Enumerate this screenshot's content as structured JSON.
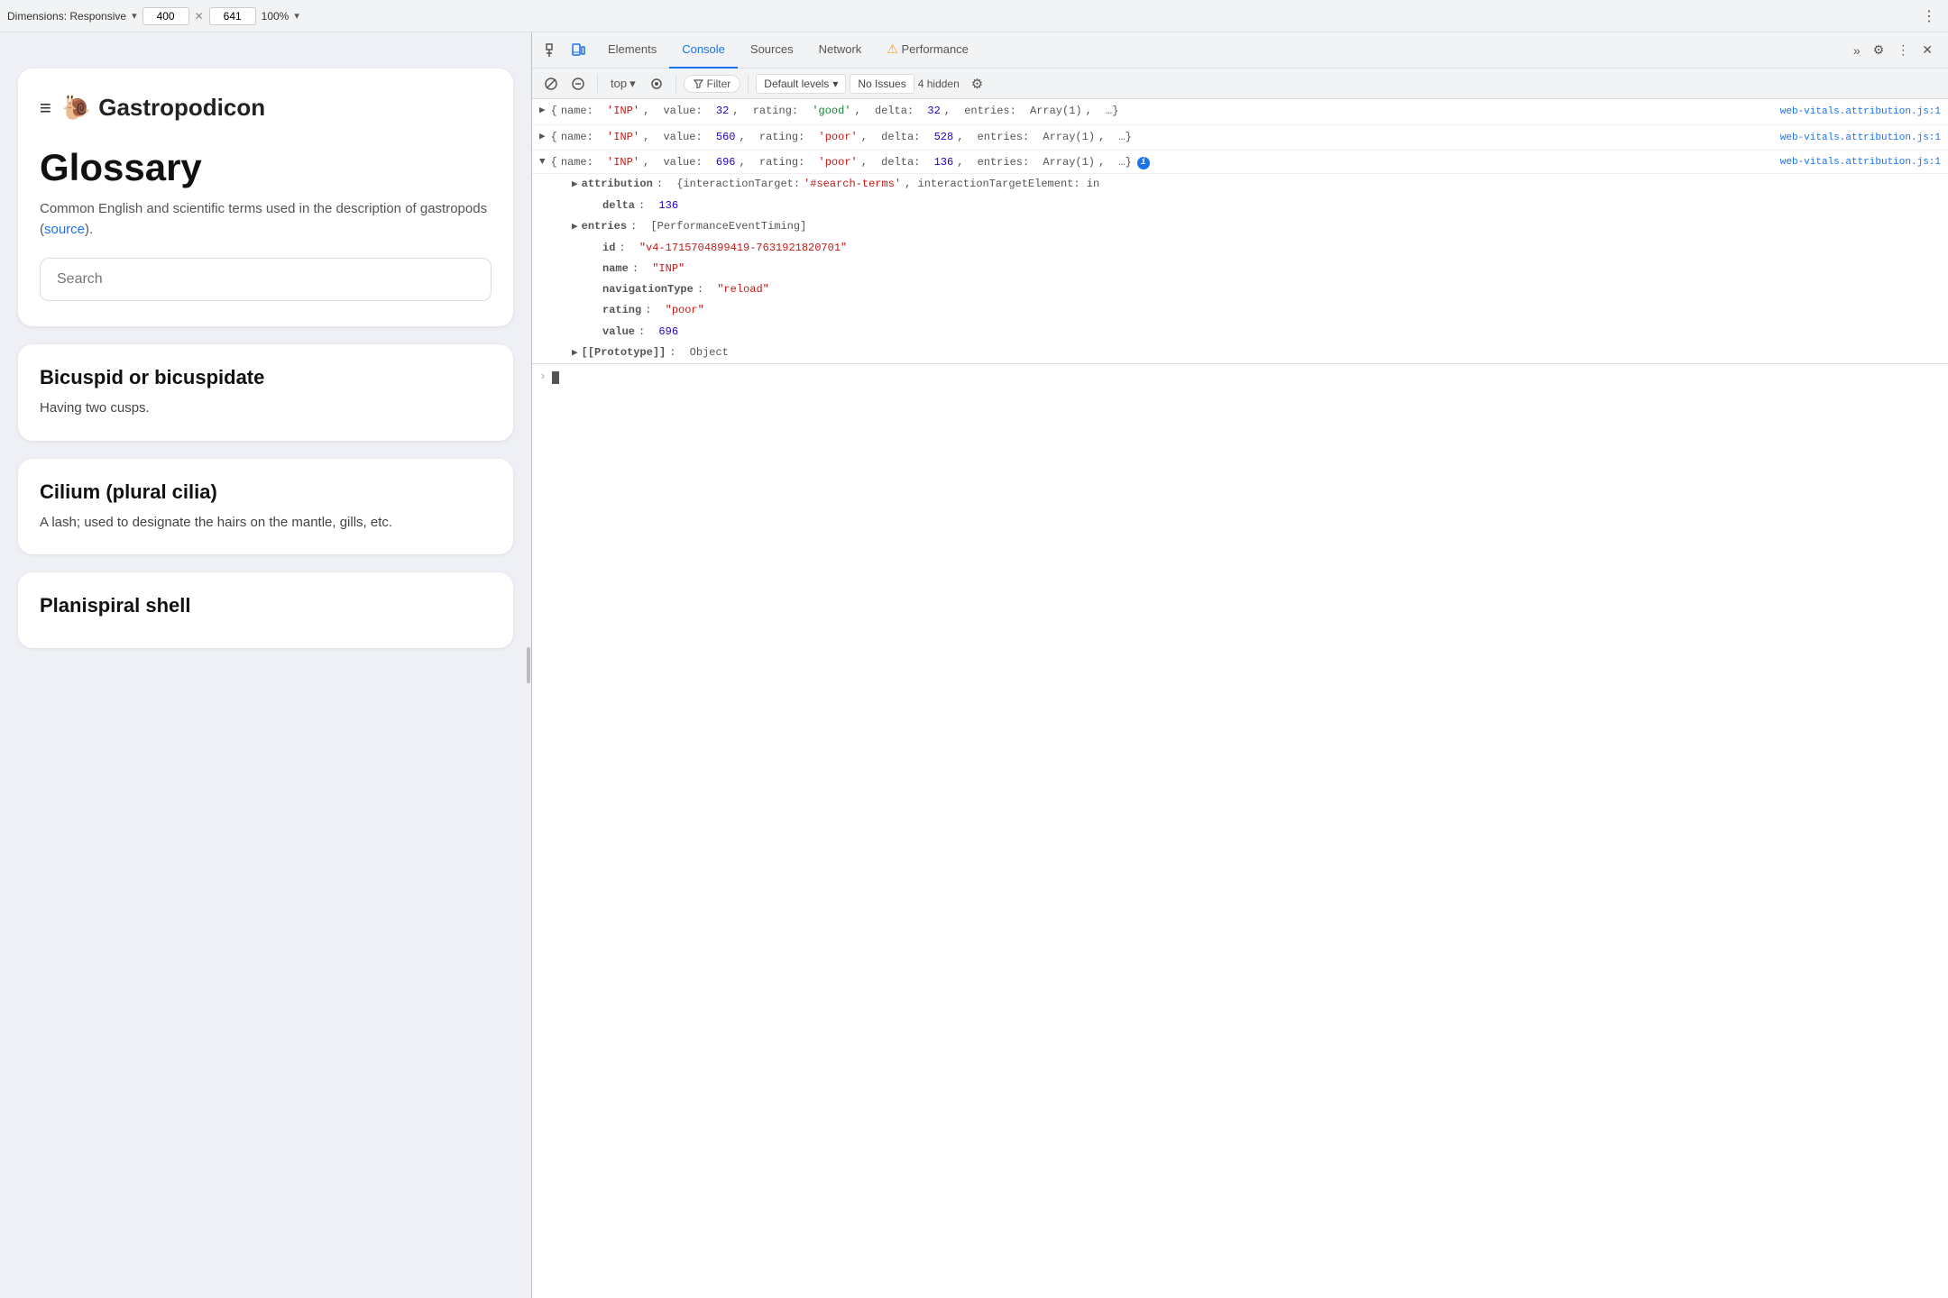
{
  "topbar": {
    "dimensions_label": "Dimensions: Responsive",
    "width_value": "400",
    "height_value": "641",
    "zoom_value": "100%",
    "dropdown_arrow": "▾",
    "close_icon": "✕"
  },
  "browser": {
    "site": {
      "hamburger": "≡",
      "snail": "🐌",
      "title": "Gastropodicon"
    },
    "glossary": {
      "heading": "Glossary",
      "description_part1": "Common English and scientific terms used in the description of gastropods (",
      "source_link_text": "source",
      "description_part2": ").",
      "search_placeholder": "Search"
    },
    "terms": [
      {
        "title": "Bicuspid or bicuspidate",
        "description": "Having two cusps."
      },
      {
        "title": "Cilium (plural cilia)",
        "description": "A lash; used to designate the hairs on the mantle, gills, etc."
      },
      {
        "title": "Planispiral shell",
        "description": ""
      }
    ]
  },
  "devtools": {
    "tabs": [
      {
        "id": "elements",
        "label": "Elements"
      },
      {
        "id": "console",
        "label": "Console"
      },
      {
        "id": "sources",
        "label": "Sources"
      },
      {
        "id": "network",
        "label": "Network"
      },
      {
        "id": "performance",
        "label": "Performance"
      }
    ],
    "active_tab": "console",
    "more_icon": "»",
    "settings_icon": "⚙",
    "close_icon": "✕",
    "overflow_icon": "⋮",
    "toolbar": {
      "ban_icon": "🚫",
      "clear_icon": "⊘",
      "top_label": "top",
      "top_dropdown": "▾",
      "eye_icon": "👁",
      "filter_label": "Filter",
      "levels_label": "Default levels",
      "levels_dropdown": "▾",
      "no_issues_label": "No Issues",
      "hidden_count": "4 hidden"
    },
    "console_entries": [
      {
        "id": "entry1",
        "collapsed": true,
        "source_file": "web-vitals.attribution.js:1",
        "inline_text": "{name: 'INP', value: 32, rating: 'good', delta: 32, entries: Array(1), …}"
      },
      {
        "id": "entry2",
        "collapsed": true,
        "source_file": "web-vitals.attribution.js:1",
        "inline_text": "{name: 'INP', value: 560, rating: 'poor', delta: 528, entries: Array(1), …}"
      },
      {
        "id": "entry3",
        "collapsed": false,
        "source_file": "web-vitals.attribution.js:1",
        "inline_text": "{name: 'INP', value: 696, rating: 'poor', delta: 136, entries: Array(1), …}",
        "info_badge": "i",
        "properties": [
          {
            "indent": 2,
            "key": "attribution",
            "colon": ":",
            "value": "{interactionTarget: '#search-terms', interactionTargetElement: in",
            "value_type": "object_summary"
          },
          {
            "indent": 3,
            "key": "delta",
            "colon": ":",
            "value": "136",
            "value_type": "number"
          },
          {
            "indent": 2,
            "key": "entries",
            "colon": ":",
            "value": "[PerformanceEventTiming]",
            "value_type": "array",
            "collapsed": true
          },
          {
            "indent": 3,
            "key": "id",
            "colon": ":",
            "value": "\"v4-1715704899419-7631921820701\"",
            "value_type": "string"
          },
          {
            "indent": 3,
            "key": "name",
            "colon": ":",
            "value": "\"INP\"",
            "value_type": "string"
          },
          {
            "indent": 3,
            "key": "navigationType",
            "colon": ":",
            "value": "\"reload\"",
            "value_type": "string"
          },
          {
            "indent": 3,
            "key": "rating",
            "colon": ":",
            "value": "\"poor\"",
            "value_type": "string"
          },
          {
            "indent": 3,
            "key": "value",
            "colon": ":",
            "value": "696",
            "value_type": "number"
          },
          {
            "indent": 2,
            "key": "[[Prototype]]",
            "colon": ":",
            "value": "Object",
            "value_type": "proto",
            "collapsed": true
          }
        ]
      }
    ]
  }
}
